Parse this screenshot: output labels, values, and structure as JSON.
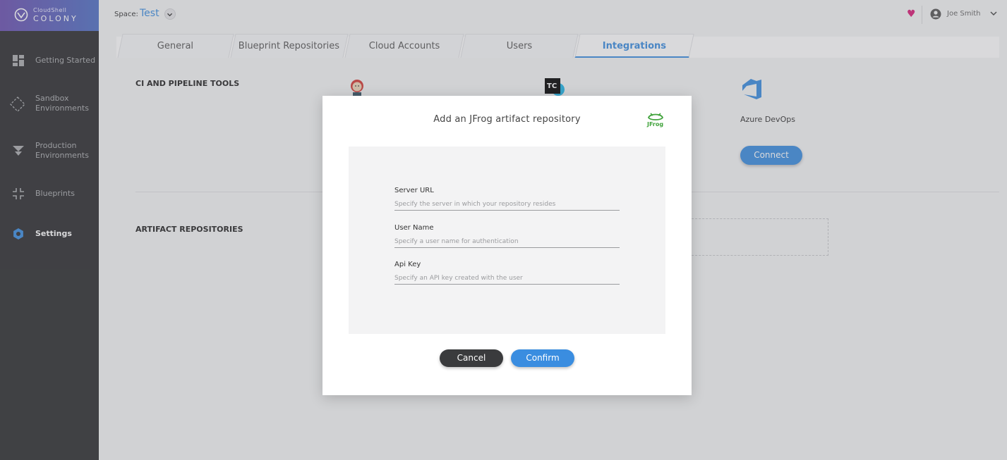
{
  "logo": {
    "small": "CloudShell",
    "big": "COLONY"
  },
  "sidebar": {
    "items": [
      {
        "label": "Getting Started",
        "icon": "dashboard-icon"
      },
      {
        "label": "Sandbox Environments",
        "icon": "sandbox-icon"
      },
      {
        "label": "Production Environments",
        "icon": "funnel-icon"
      },
      {
        "label": "Blueprints",
        "icon": "blueprints-icon"
      },
      {
        "label": "Settings",
        "icon": "gear-icon",
        "active": true
      }
    ]
  },
  "header": {
    "space_label": "Space:",
    "space_name": "Test",
    "user_name": "Joe Smith"
  },
  "tabs": [
    {
      "label": "General"
    },
    {
      "label": "Blueprint Repositories"
    },
    {
      "label": "Cloud Accounts"
    },
    {
      "label": "Users"
    },
    {
      "label": "Integrations",
      "active": true
    }
  ],
  "content": {
    "ci_title": "CI AND PIPELINE TOOLS",
    "tools": [
      {
        "name": "Jenkins",
        "icon": "jenkins-icon"
      },
      {
        "name": "TeamCity",
        "icon": "teamcity-icon",
        "badge": "TC"
      },
      {
        "name": "Azure DevOps",
        "icon": "azure-devops-icon"
      }
    ],
    "connect_label": "Connect",
    "artifact_title": "ARTIFACT REPOSITORIES"
  },
  "modal": {
    "title": "Add an JFrog artifact repository",
    "logo_text": "JFrog",
    "fields": [
      {
        "label": "Server URL",
        "placeholder": "Specify the server in which your repository resides",
        "value": ""
      },
      {
        "label": "User Name",
        "placeholder": "Specify a user name for authentication",
        "value": ""
      },
      {
        "label": "Api Key",
        "placeholder": "Specify an API key created with the user",
        "value": ""
      }
    ],
    "cancel_label": "Cancel",
    "confirm_label": "Confirm"
  },
  "colors": {
    "accent": "#3a8de0",
    "sidebar": "#2b2c2e",
    "heart": "#d81b76"
  }
}
